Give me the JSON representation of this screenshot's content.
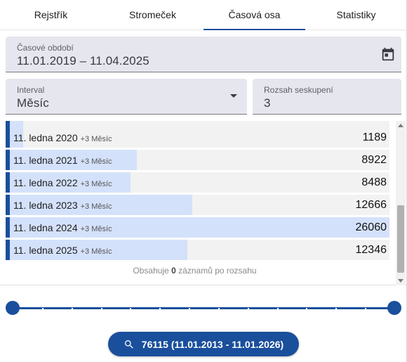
{
  "tabs": [
    {
      "label": "Rejstřík",
      "active": false
    },
    {
      "label": "Stromeček",
      "active": false
    },
    {
      "label": "Časová osa",
      "active": true
    },
    {
      "label": "Statistiky",
      "active": false
    }
  ],
  "period_field": {
    "label": "Časové období",
    "value": "11.01.2019 – 11.04.2025",
    "icon": "calendar-icon"
  },
  "interval_field": {
    "label": "Interval",
    "value": "Měsíc",
    "icon": "dropdown-arrow-icon"
  },
  "range_field": {
    "label": "Rozsah seskupení",
    "value": "3"
  },
  "rows": [
    {
      "date": "11. ledna 2020",
      "extra": "+3 Měsíc",
      "count": "1189",
      "fill": 0.0456
    },
    {
      "date": "11. ledna 2021",
      "extra": "+3 Měsíc",
      "count": "8922",
      "fill": 0.342
    },
    {
      "date": "11. ledna 2022",
      "extra": "+3 Měsíc",
      "count": "8488",
      "fill": 0.326
    },
    {
      "date": "11. ledna 2023",
      "extra": "+3 Měsíc",
      "count": "12666",
      "fill": 0.486
    },
    {
      "date": "11. ledna 2024",
      "extra": "+3 Měsíc",
      "count": "26060",
      "fill": 1.0
    },
    {
      "date": "11. ledna 2025",
      "extra": "+3 Měsíc",
      "count": "12346",
      "fill": 0.474
    }
  ],
  "partial_row_fill": 0.0456,
  "footer_note": {
    "prefix": "Obsahuje",
    "count": "0",
    "suffix": "záznamů po rozsahu"
  },
  "slider": {
    "ticks": 13,
    "start": 0,
    "end": 1
  },
  "search_button": {
    "label": "76115 (11.01.2013 - 11.01.2026)",
    "icon": "search-icon"
  },
  "colors": {
    "accent": "#1a4f9c",
    "bar_fill": "#d4e1fb",
    "field_bg": "#e6e6ee"
  }
}
